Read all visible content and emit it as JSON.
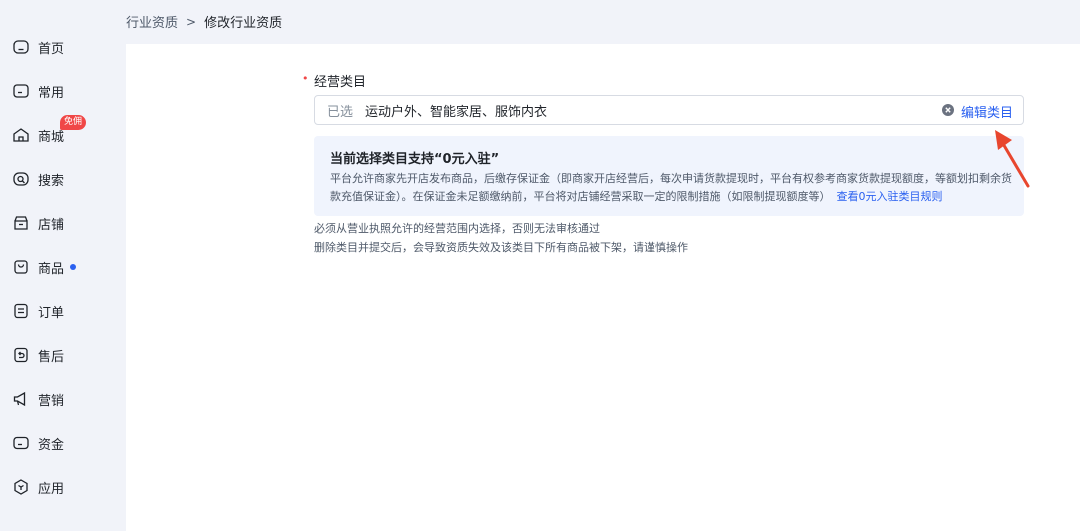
{
  "breadcrumb": {
    "parent": "行业资质",
    "separator": ">",
    "current": "修改行业资质"
  },
  "sidebar": {
    "items": [
      {
        "label": "首页",
        "icon": "home-icon"
      },
      {
        "label": "常用",
        "icon": "folder-icon"
      },
      {
        "label": "商城",
        "icon": "shop-icon",
        "badge": "免佣"
      },
      {
        "label": "搜索",
        "icon": "search-icon"
      },
      {
        "label": "店铺",
        "icon": "store-icon"
      },
      {
        "label": "商品",
        "icon": "product-bag-icon",
        "dot": true
      },
      {
        "label": "订单",
        "icon": "order-list-icon"
      },
      {
        "label": "售后",
        "icon": "aftersale-return-icon"
      },
      {
        "label": "营销",
        "icon": "megaphone-icon"
      },
      {
        "label": "资金",
        "icon": "wallet-icon"
      },
      {
        "label": "应用",
        "icon": "app-hexagon-icon"
      }
    ]
  },
  "form": {
    "required_mark": "•",
    "label": "经营类目",
    "select": {
      "prefix": "已选",
      "value": "运动户外、智能家居、服饰内衣",
      "action": "编辑类目"
    },
    "notice": {
      "title": "当前选择类目支持“0元入驻”",
      "body": "平台允许商家先开店发布商品，后缴存保证金（即商家开店经营后，每次申请货款提现时，平台有权参考商家货款提现额度，等额划扣剩余货款充值保证金）。在保证金未足额缴纳前，平台将对店铺经营采取一定的限制措施（如限制提现额度等）",
      "link": "查看0元入驻类目规则"
    },
    "help_lines": [
      "必须从营业执照允许的经营范围内选择，否则无法审核通过",
      "删除类目并提交后，会导致资质失效及该类目下所有商品被下架，请谨慎操作"
    ]
  },
  "colors": {
    "accent": "#2a60f0",
    "badge": "#f04747",
    "annotation_arrow": "#e8462e",
    "notice_bg": "#f0f4fd"
  }
}
